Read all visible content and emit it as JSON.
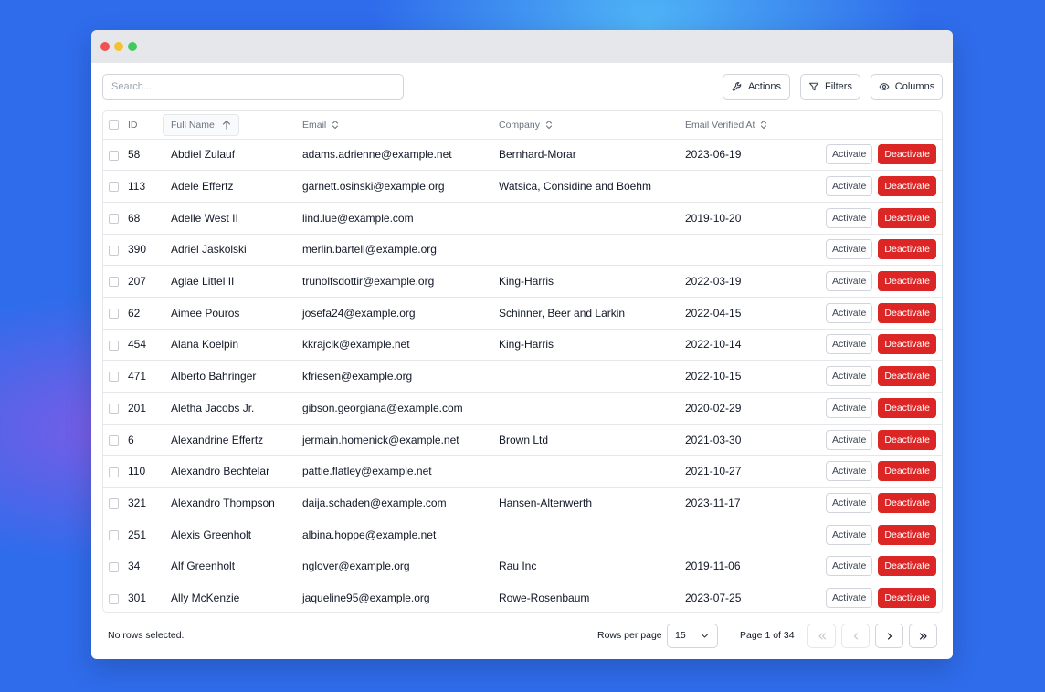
{
  "search": {
    "placeholder": "Search..."
  },
  "toolbar": {
    "actions_label": "Actions",
    "filters_label": "Filters",
    "columns_label": "Columns"
  },
  "table": {
    "headers": {
      "id": "ID",
      "full_name": "Full Name",
      "email": "Email",
      "company": "Company",
      "email_verified_at": "Email Verified At"
    },
    "sorted_column": "full_name",
    "sort_direction": "asc",
    "activate_label": "Activate",
    "deactivate_label": "Deactivate",
    "rows": [
      {
        "id": "58",
        "name": "Abdiel Zulauf",
        "email": "adams.adrienne@example.net",
        "company": "Bernhard-Morar",
        "verified": "2023-06-19"
      },
      {
        "id": "113",
        "name": "Adele Effertz",
        "email": "garnett.osinski@example.org",
        "company": "Watsica, Considine and Boehm",
        "verified": ""
      },
      {
        "id": "68",
        "name": "Adelle West II",
        "email": "lind.lue@example.com",
        "company": "",
        "verified": "2019-10-20"
      },
      {
        "id": "390",
        "name": "Adriel Jaskolski",
        "email": "merlin.bartell@example.org",
        "company": "",
        "verified": ""
      },
      {
        "id": "207",
        "name": "Aglae Littel II",
        "email": "trunolfsdottir@example.org",
        "company": "King-Harris",
        "verified": "2022-03-19"
      },
      {
        "id": "62",
        "name": "Aimee Pouros",
        "email": "josefa24@example.org",
        "company": "Schinner, Beer and Larkin",
        "verified": "2022-04-15"
      },
      {
        "id": "454",
        "name": "Alana Koelpin",
        "email": "kkrajcik@example.net",
        "company": "King-Harris",
        "verified": "2022-10-14"
      },
      {
        "id": "471",
        "name": "Alberto Bahringer",
        "email": "kfriesen@example.org",
        "company": "",
        "verified": "2022-10-15"
      },
      {
        "id": "201",
        "name": "Aletha Jacobs Jr.",
        "email": "gibson.georgiana@example.com",
        "company": "",
        "verified": "2020-02-29"
      },
      {
        "id": "6",
        "name": "Alexandrine Effertz",
        "email": "jermain.homenick@example.net",
        "company": "Brown Ltd",
        "verified": "2021-03-30"
      },
      {
        "id": "110",
        "name": "Alexandro Bechtelar",
        "email": "pattie.flatley@example.net",
        "company": "",
        "verified": "2021-10-27"
      },
      {
        "id": "321",
        "name": "Alexandro Thompson",
        "email": "daija.schaden@example.com",
        "company": "Hansen-Altenwerth",
        "verified": "2023-11-17"
      },
      {
        "id": "251",
        "name": "Alexis Greenholt",
        "email": "albina.hoppe@example.net",
        "company": "",
        "verified": ""
      },
      {
        "id": "34",
        "name": "Alf Greenholt",
        "email": "nglover@example.org",
        "company": "Rau Inc",
        "verified": "2019-11-06"
      },
      {
        "id": "301",
        "name": "Ally McKenzie",
        "email": "jaqueline95@example.org",
        "company": "Rowe-Rosenbaum",
        "verified": "2023-07-25"
      }
    ]
  },
  "footer": {
    "selection_text": "No rows selected.",
    "rows_per_page_label": "Rows per page",
    "rows_per_page_value": "15",
    "page_info": "Page 1 of 34"
  },
  "colors": {
    "deactivate": "#dc2626",
    "background": "#2f6ceb",
    "titlebar": "#e5e7eb"
  },
  "icons": {
    "actions": "wrench-icon",
    "filters": "filter-icon",
    "columns": "eye-icon",
    "sort_asc": "arrow-up-icon",
    "sortable": "chevron-up-down-icon",
    "first_page": "double-chevron-left-icon",
    "prev_page": "chevron-left-icon",
    "next_page": "chevron-right-icon",
    "last_page": "double-chevron-right-icon"
  }
}
